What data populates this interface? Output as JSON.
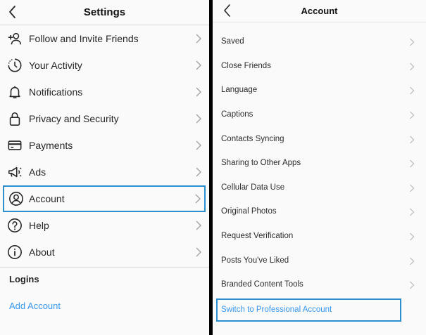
{
  "settings": {
    "title": "Settings",
    "items": [
      {
        "label": "Follow and Invite Friends",
        "icon": "add-person-icon"
      },
      {
        "label": "Your Activity",
        "icon": "activity-clock-icon"
      },
      {
        "label": "Notifications",
        "icon": "bell-icon"
      },
      {
        "label": "Privacy and Security",
        "icon": "lock-icon"
      },
      {
        "label": "Payments",
        "icon": "card-icon"
      },
      {
        "label": "Ads",
        "icon": "megaphone-icon"
      },
      {
        "label": "Account",
        "icon": "account-circle-icon"
      },
      {
        "label": "Help",
        "icon": "help-circle-icon"
      },
      {
        "label": "About",
        "icon": "info-circle-icon"
      }
    ],
    "logins_title": "Logins",
    "add_account": "Add Account"
  },
  "account": {
    "title": "Account",
    "items": [
      "Saved",
      "Close Friends",
      "Language",
      "Captions",
      "Contacts Syncing",
      "Sharing to Other Apps",
      "Cellular Data Use",
      "Original Photos",
      "Request Verification",
      "Posts You've Liked",
      "Branded Content Tools"
    ],
    "switch_pro": "Switch to Professional Account"
  },
  "colors": {
    "accent_link": "#3897f0",
    "highlight_border": "#2b8fd0",
    "background": "#fafafa"
  }
}
